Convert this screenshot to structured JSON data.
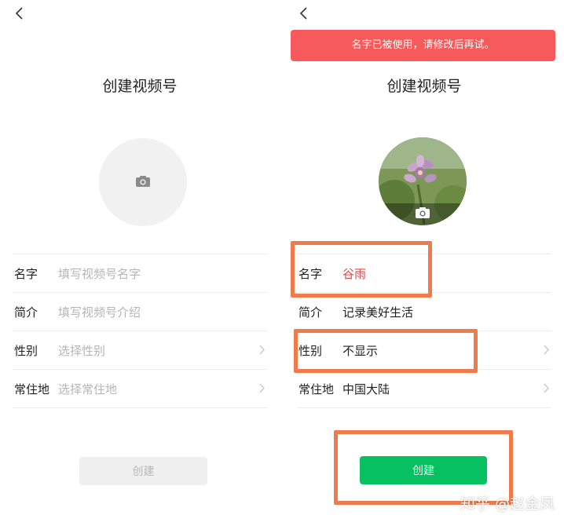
{
  "left": {
    "title": "创建视频号",
    "fields": [
      {
        "label": "名字",
        "placeholder": "填写视频号名字"
      },
      {
        "label": "简介",
        "placeholder": "填写视频号介绍"
      },
      {
        "label": "性别",
        "placeholder": "选择性别"
      },
      {
        "label": "常住地",
        "placeholder": "选择常住地"
      }
    ],
    "create_label": "创建"
  },
  "right": {
    "toast": "名字已被使用，请修改后再试。",
    "title": "创建视频号",
    "fields": [
      {
        "label": "名字",
        "value": "谷雨"
      },
      {
        "label": "简介",
        "value": "记录美好生活"
      },
      {
        "label": "性别",
        "value": "不显示"
      },
      {
        "label": "常住地",
        "value": "中国大陆"
      }
    ],
    "create_label": "创建"
  },
  "watermark": "知乎 @赵金凤",
  "colors": {
    "accent_green": "#07c160",
    "error_red": "#f75a5a",
    "highlight_orange": "#ef7a4c"
  }
}
